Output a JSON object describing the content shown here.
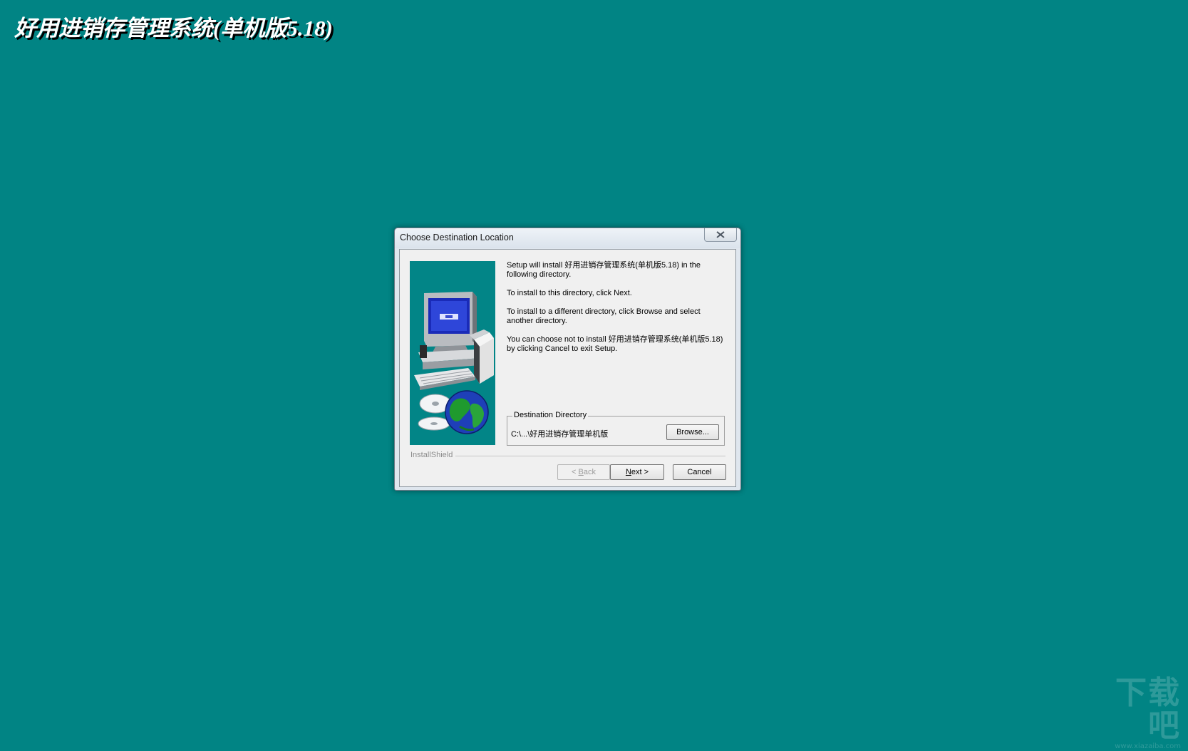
{
  "banner": {
    "title": "好用进销存管理系统(单机版5.18)"
  },
  "watermark": {
    "text": "下载吧",
    "url": "www.xiazaiba.com"
  },
  "dialog": {
    "title": "Choose Destination Location",
    "paragraphs": [
      "Setup will install 好用进销存管理系统(单机版5.18) in the following directory.",
      "To install to this directory, click Next.",
      "To install to a different directory, click Browse and select another directory.",
      "You can choose not to install 好用进销存管理系统(单机版5.18) by clicking Cancel to exit Setup."
    ],
    "destination": {
      "legend": "Destination Directory",
      "path": "C:\\...\\好用进销存管理单机版",
      "browse_label": "Browse..."
    },
    "brand": "InstallShield",
    "buttons": {
      "back_prefix": "< ",
      "back_hotkey": "B",
      "back_rest": "ack",
      "next_hotkey": "N",
      "next_rest": "ext >",
      "cancel": "Cancel"
    }
  },
  "colors": {
    "desktop": "#018484",
    "side_image": "#028587"
  }
}
